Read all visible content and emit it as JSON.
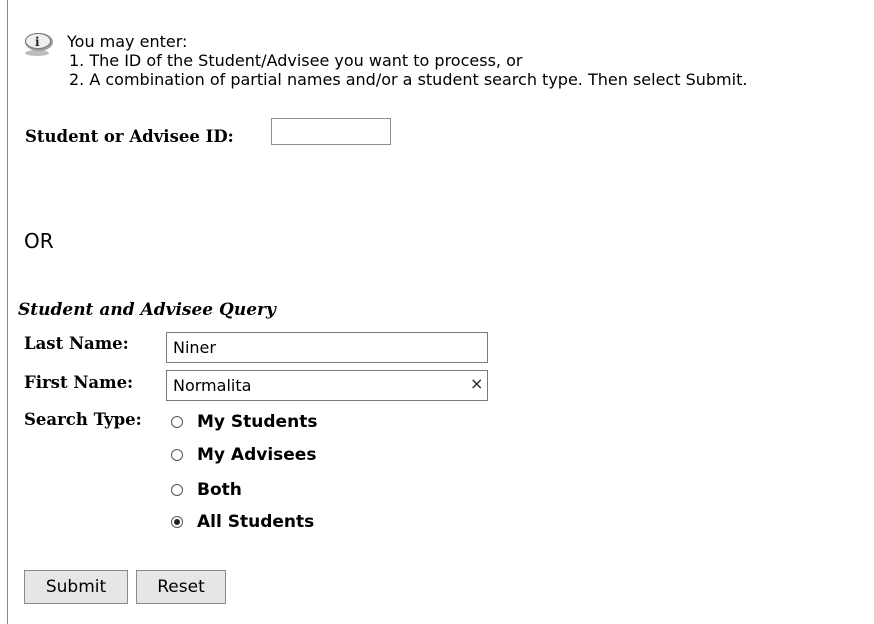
{
  "info": {
    "icon": "info-icon",
    "lines": [
      "You may enter:",
      "1. The ID of the Student/Advisee you want to process, or",
      "2. A combination of partial names and/or a student search type. Then select Submit."
    ]
  },
  "id_search": {
    "label": "Student or Advisee ID:",
    "value": ""
  },
  "or_text": "OR",
  "query": {
    "title": "Student and Advisee Query",
    "last_name": {
      "label": "Last Name:",
      "value": "Niner"
    },
    "first_name": {
      "label": "First Name:",
      "value": "Normalita",
      "clear_icon": "×"
    },
    "search_type": {
      "label": "Search Type:",
      "options": [
        "My Students",
        "My Advisees",
        "Both",
        "All Students"
      ],
      "selected": "All Students"
    }
  },
  "buttons": {
    "submit": "Submit",
    "reset": "Reset"
  }
}
